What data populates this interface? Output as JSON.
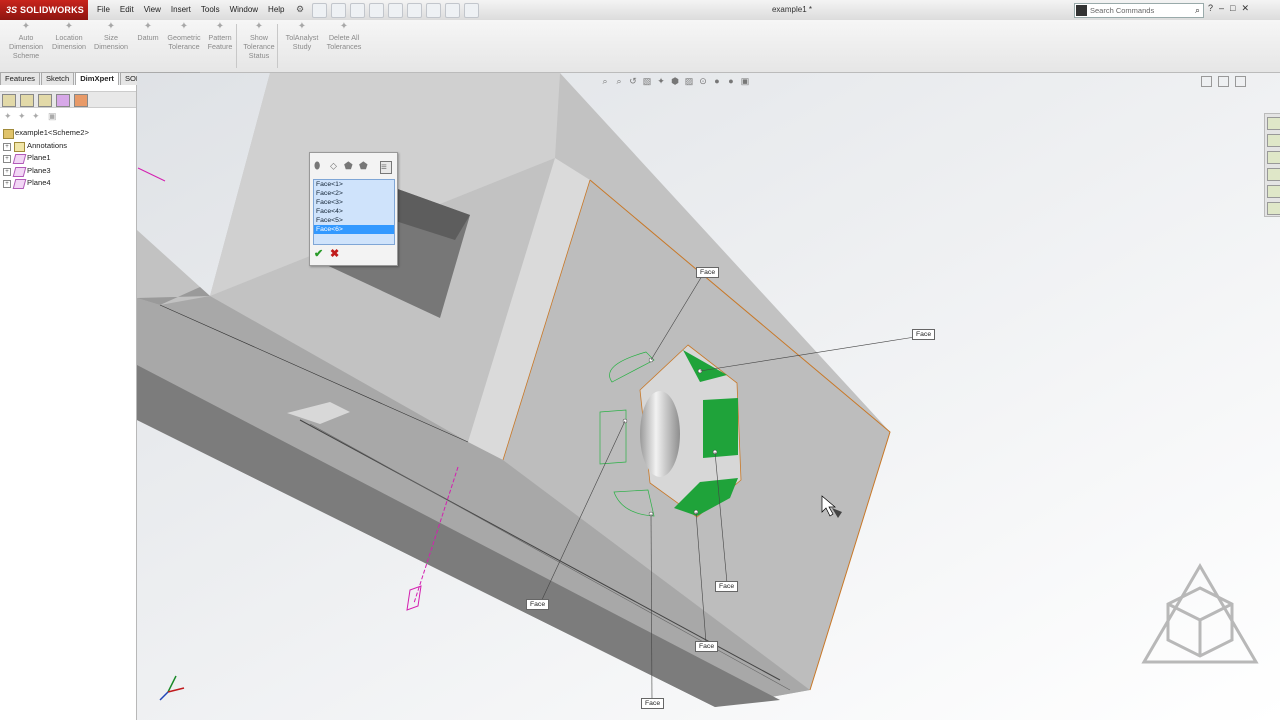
{
  "app": {
    "brand": "SOLIDWORKS",
    "document_title": "example1 *"
  },
  "menu": [
    "File",
    "Edit",
    "View",
    "Insert",
    "Tools",
    "Window",
    "Help"
  ],
  "search": {
    "placeholder": "Search Commands"
  },
  "commands": [
    {
      "label": "Auto\nDimension\nScheme",
      "icon": "auto-dimension-scheme-icon"
    },
    {
      "label": "Location\nDimension",
      "icon": "location-dimension-icon"
    },
    {
      "label": "Size\nDimension",
      "icon": "size-dimension-icon"
    },
    {
      "label": "Datum",
      "icon": "datum-icon"
    },
    {
      "label": "Geometric\nTolerance",
      "icon": "geometric-tolerance-icon"
    },
    {
      "label": "Pattern\nFeature",
      "icon": "pattern-feature-icon"
    },
    {
      "label": "Show\nTolerance\nStatus",
      "icon": "show-tolerance-status-icon"
    },
    {
      "label": "TolAnalyst\nStudy",
      "icon": "tolanalyst-study-icon"
    },
    {
      "label": "Delete All\nTolerances",
      "icon": "delete-all-tolerances-icon"
    }
  ],
  "tabs": [
    {
      "label": "Features",
      "active": false
    },
    {
      "label": "Sketch",
      "active": false
    },
    {
      "label": "DimXpert",
      "active": true
    },
    {
      "label": "SOLIDWORKS MBD",
      "active": false
    }
  ],
  "tree": [
    {
      "label": "example1<Scheme2>",
      "icon": "part-icon",
      "depth": 0
    },
    {
      "label": "Annotations",
      "icon": "annotations-icon",
      "depth": 1
    },
    {
      "label": "Plane1",
      "icon": "plane-icon",
      "depth": 1
    },
    {
      "label": "Plane3",
      "icon": "plane-icon",
      "depth": 1
    },
    {
      "label": "Plane4",
      "icon": "plane-icon",
      "depth": 1
    }
  ],
  "selection_box": {
    "items": [
      "Face<1>",
      "Face<2>",
      "Face<3>",
      "Face<4>",
      "Face<5>",
      "Face<6>"
    ],
    "selected_index": 5
  },
  "callouts": [
    "Face",
    "Face",
    "Face",
    "Face",
    "Face",
    "Face"
  ],
  "colors": {
    "accent_green": "#1fa33a",
    "edge_orange": "#c87828",
    "axis_magenta": "#d41fb0",
    "brand_red": "#b81d18"
  }
}
